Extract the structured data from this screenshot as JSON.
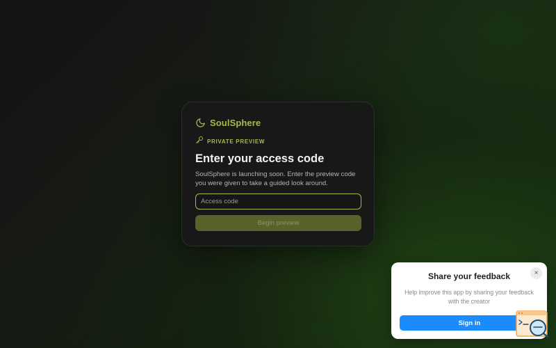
{
  "card": {
    "brand_name": "SoulSphere",
    "eyebrow": "PRIVATE PREVIEW",
    "title": "Enter your access code",
    "description": "SoulSphere is launching soon. Enter the preview code you were given to take a guided look around.",
    "input_placeholder": "Access code",
    "input_value": "",
    "submit_label": "Begin preview"
  },
  "feedback": {
    "title": "Share your feedback",
    "close_label": "×",
    "text": "Help improve this app by sharing your feedback with the creator",
    "signin_label": "Sign in"
  },
  "icons": {
    "brand": "moon-icon",
    "eyebrow": "key-icon",
    "close": "close-icon",
    "helper": "chat-search-icon"
  },
  "colors": {
    "accent": "#a2bd4c",
    "button_disabled": "#59622a",
    "signin": "#1a8cff",
    "background": "#141414"
  }
}
